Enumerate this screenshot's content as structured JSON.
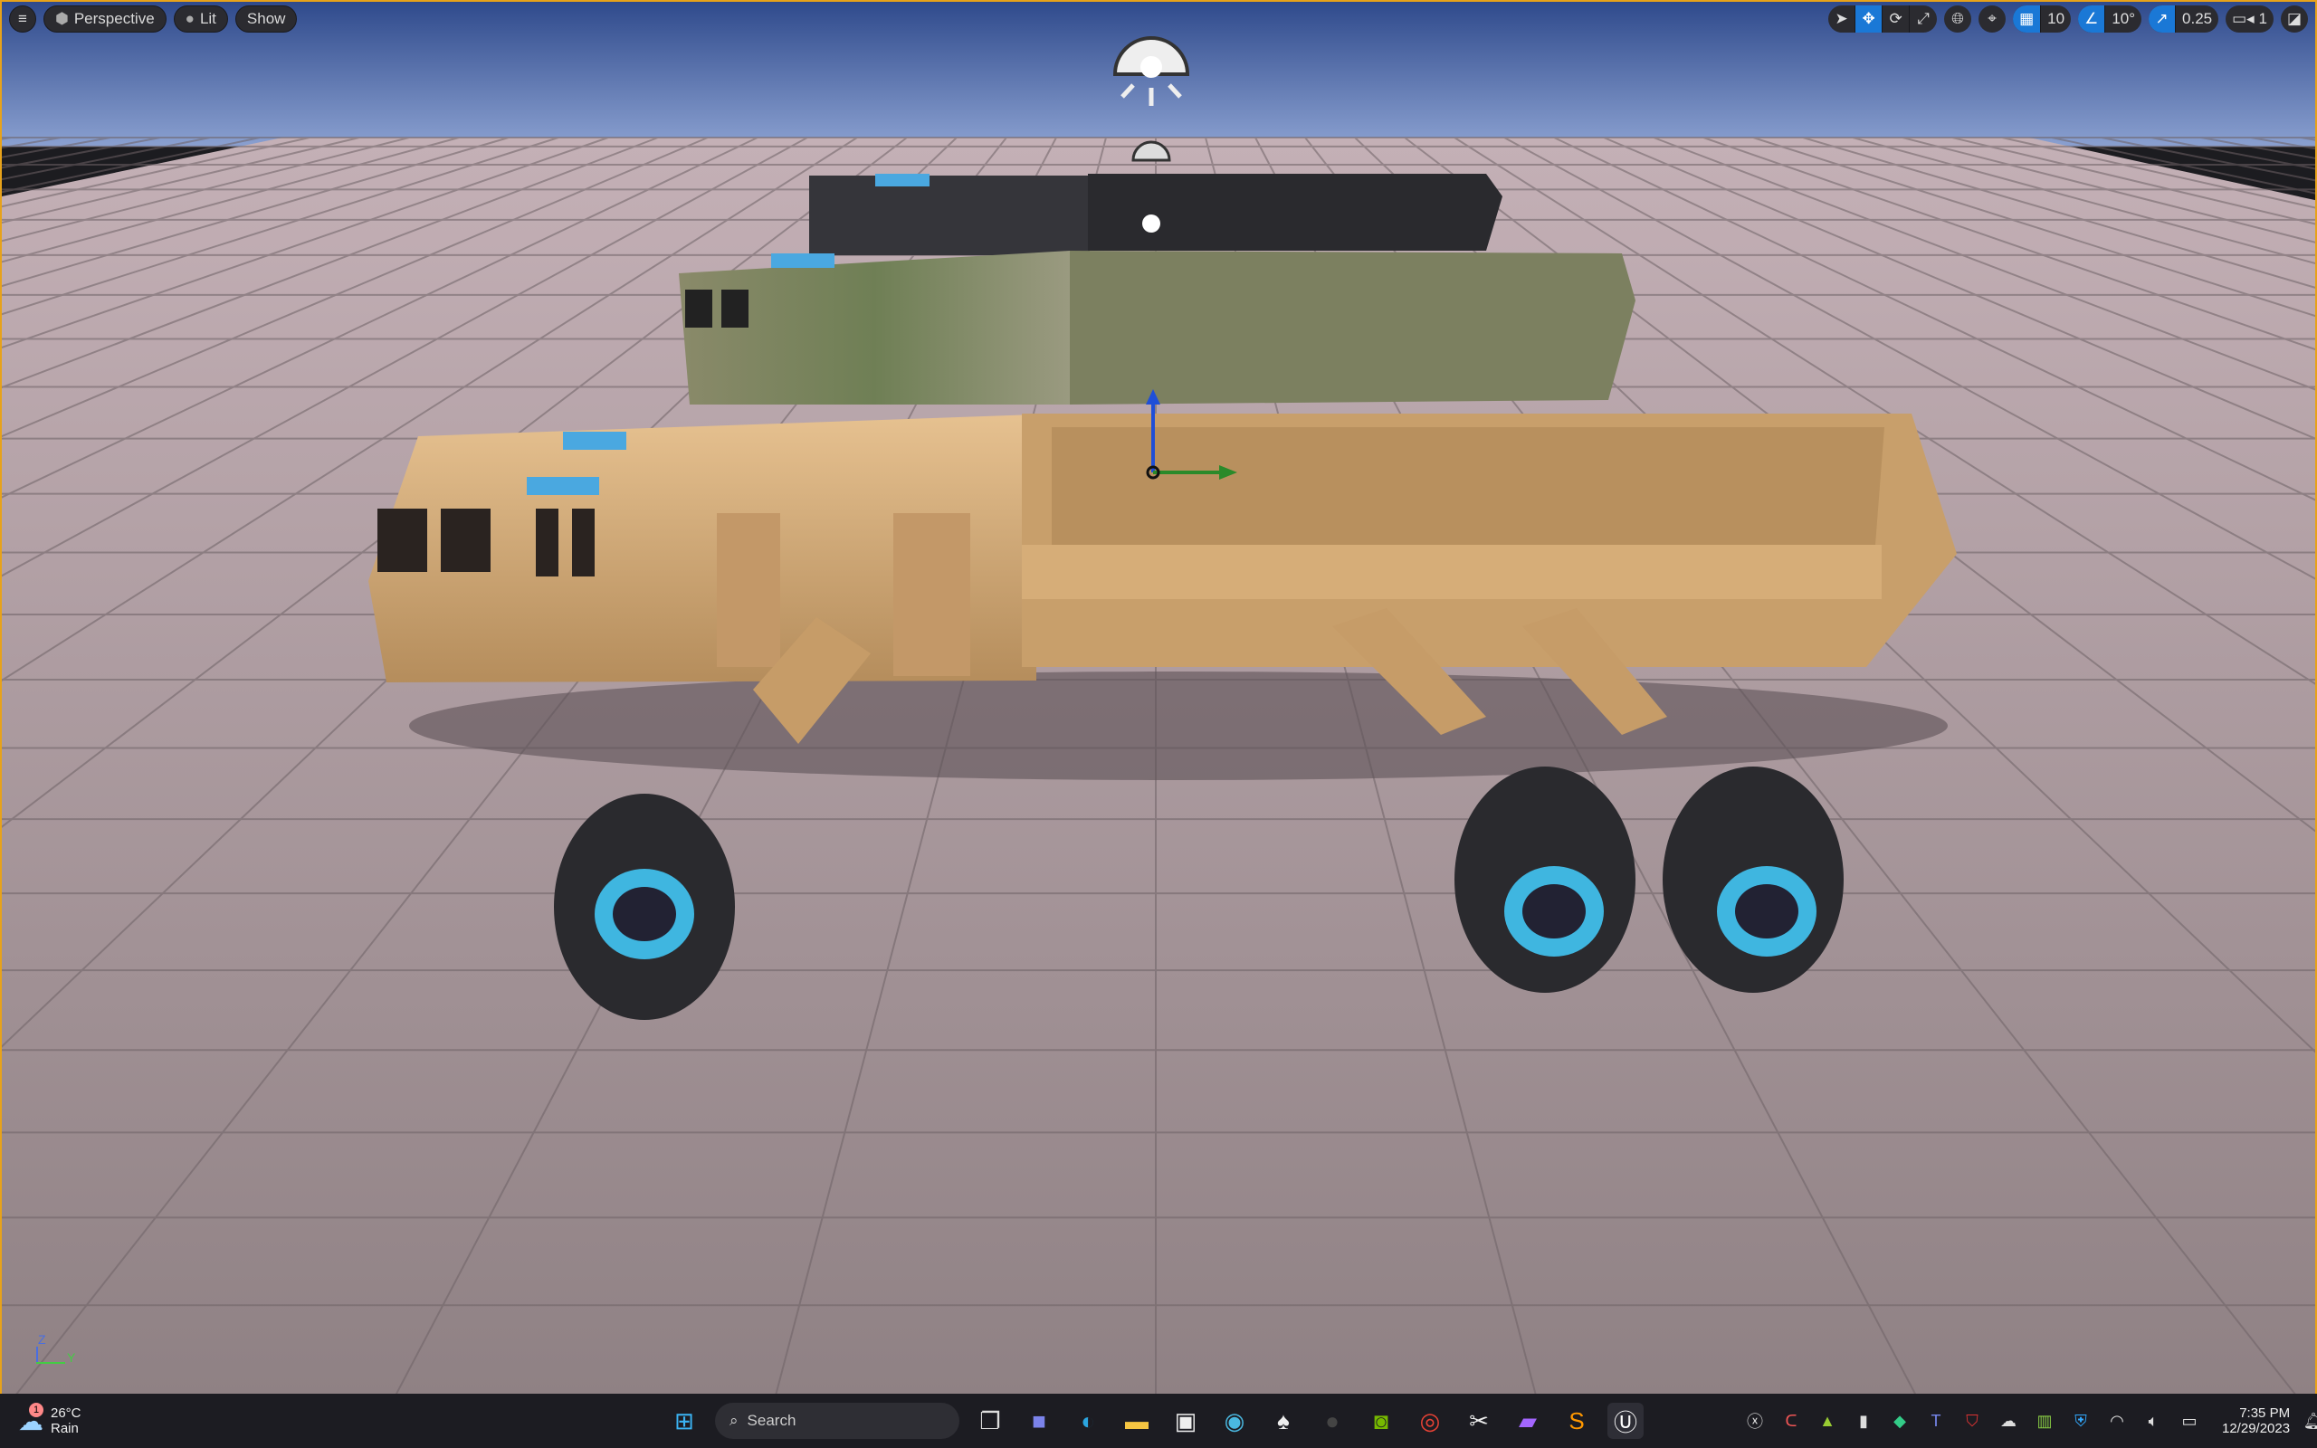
{
  "viewport_toolbar": {
    "menu_icon": "hamburger-icon",
    "perspective_label": "Perspective",
    "lit_label": "Lit",
    "show_label": "Show",
    "grid_snap_value": "10",
    "rotation_snap_value": "10°",
    "scale_snap_value": "0.25",
    "camera_speed_value": "1"
  },
  "axis_gizmo": {
    "z": "Z",
    "y": "Y"
  },
  "taskbar": {
    "weather_temp": "26°C",
    "weather_desc": "Rain",
    "weather_badge": "1",
    "search_placeholder": "Search",
    "time": "7:35 PM",
    "date": "12/29/2023"
  },
  "colors": {
    "accent": "#1a78d6",
    "border": "#e7a21a",
    "wheel_rim": "#3fb6e0",
    "sand": "#d9b07a"
  }
}
